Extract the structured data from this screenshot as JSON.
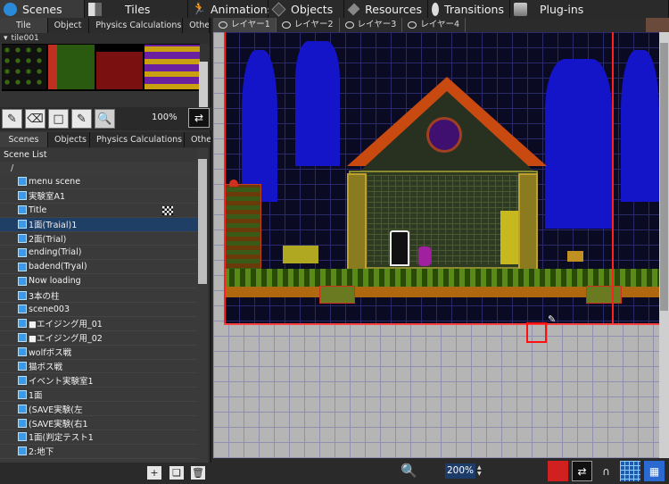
{
  "top_tabs": [
    {
      "label": "Scenes",
      "icon": "scenes-icon"
    },
    {
      "label": "Tiles",
      "icon": "tiles-icon"
    },
    {
      "label": "Animations",
      "icon": "animations-icon"
    },
    {
      "label": "Objects",
      "icon": "objects-icon"
    },
    {
      "label": "Resources",
      "icon": "resources-icon"
    },
    {
      "label": "Transitions",
      "icon": "transitions-icon"
    },
    {
      "label": "Plug-ins",
      "icon": "plugins-icon"
    }
  ],
  "upper_tabs": [
    "Tile",
    "Object",
    "Physics Calculations",
    "Other"
  ],
  "tileset": {
    "name": "tile001"
  },
  "tools": {
    "zoom": "100%"
  },
  "lower_tabs": [
    "Scenes",
    "Objects",
    "Physics Calculations",
    "Other"
  ],
  "scene_list": {
    "title": "Scene List",
    "root": "/",
    "items": [
      {
        "label": "menu scene"
      },
      {
        "label": "実験室A1"
      },
      {
        "label": "Title",
        "flag": true
      },
      {
        "label": "1面(Traial)1",
        "selected": true
      },
      {
        "label": "2面(Trial)"
      },
      {
        "label": "ending(Trial)"
      },
      {
        "label": "badend(Tryal)"
      },
      {
        "label": "Now loading"
      },
      {
        "label": "3本の柱"
      },
      {
        "label": "scene003"
      },
      {
        "label": "■エイジング用_01"
      },
      {
        "label": "■エイジング用_02"
      },
      {
        "label": "wolfボス戦"
      },
      {
        "label": "猫ボス戦"
      },
      {
        "label": "イベント実験室1"
      },
      {
        "label": "1面"
      },
      {
        "label": "(SAVE実験(左"
      },
      {
        "label": "(SAVE実験(右1"
      },
      {
        "label": "1面(判定テスト1"
      },
      {
        "label": "2:地下"
      }
    ]
  },
  "layers": [
    {
      "label": "レイヤー1",
      "active": true
    },
    {
      "label": "レイヤー2"
    },
    {
      "label": "レイヤー3"
    },
    {
      "label": "レイヤー4"
    }
  ],
  "status": {
    "zoom": "200%"
  },
  "colors": {
    "accent": "#2a8ad8",
    "selection": "#1f3f66",
    "cursor": "#ff1010"
  }
}
